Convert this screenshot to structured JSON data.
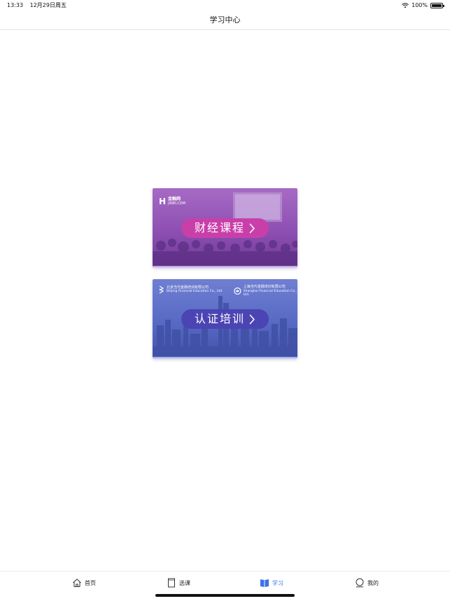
{
  "status_bar": {
    "time": "13:33",
    "date": "12月29日周五",
    "battery": "100%"
  },
  "nav": {
    "title": "学习中心"
  },
  "cards": [
    {
      "label": "财经课程",
      "logo_text": "金融网",
      "logo_sub": "JINRI.COM",
      "theme_color": "#9b56b8",
      "pill_color": "#c93faa"
    },
    {
      "label": "认证培训",
      "logo_left_cn": "北京当代金融培训有限公司",
      "logo_left_en": "Beijing Financial Education Co., Ltd.",
      "logo_right_cn": "上海当代金融培训有限公司",
      "logo_right_en": "Shanghai Financial Education Co., Ltd.",
      "theme_color": "#5a6bc4",
      "pill_color": "#4b44b3"
    }
  ],
  "tabs": [
    {
      "label": "首页",
      "icon": "home-icon",
      "active": false
    },
    {
      "label": "选课",
      "icon": "book-icon",
      "active": false
    },
    {
      "label": "学习",
      "icon": "open-book-icon",
      "active": true
    },
    {
      "label": "我的",
      "icon": "person-icon",
      "active": false
    }
  ],
  "colors": {
    "accent": "#3b73e6"
  }
}
